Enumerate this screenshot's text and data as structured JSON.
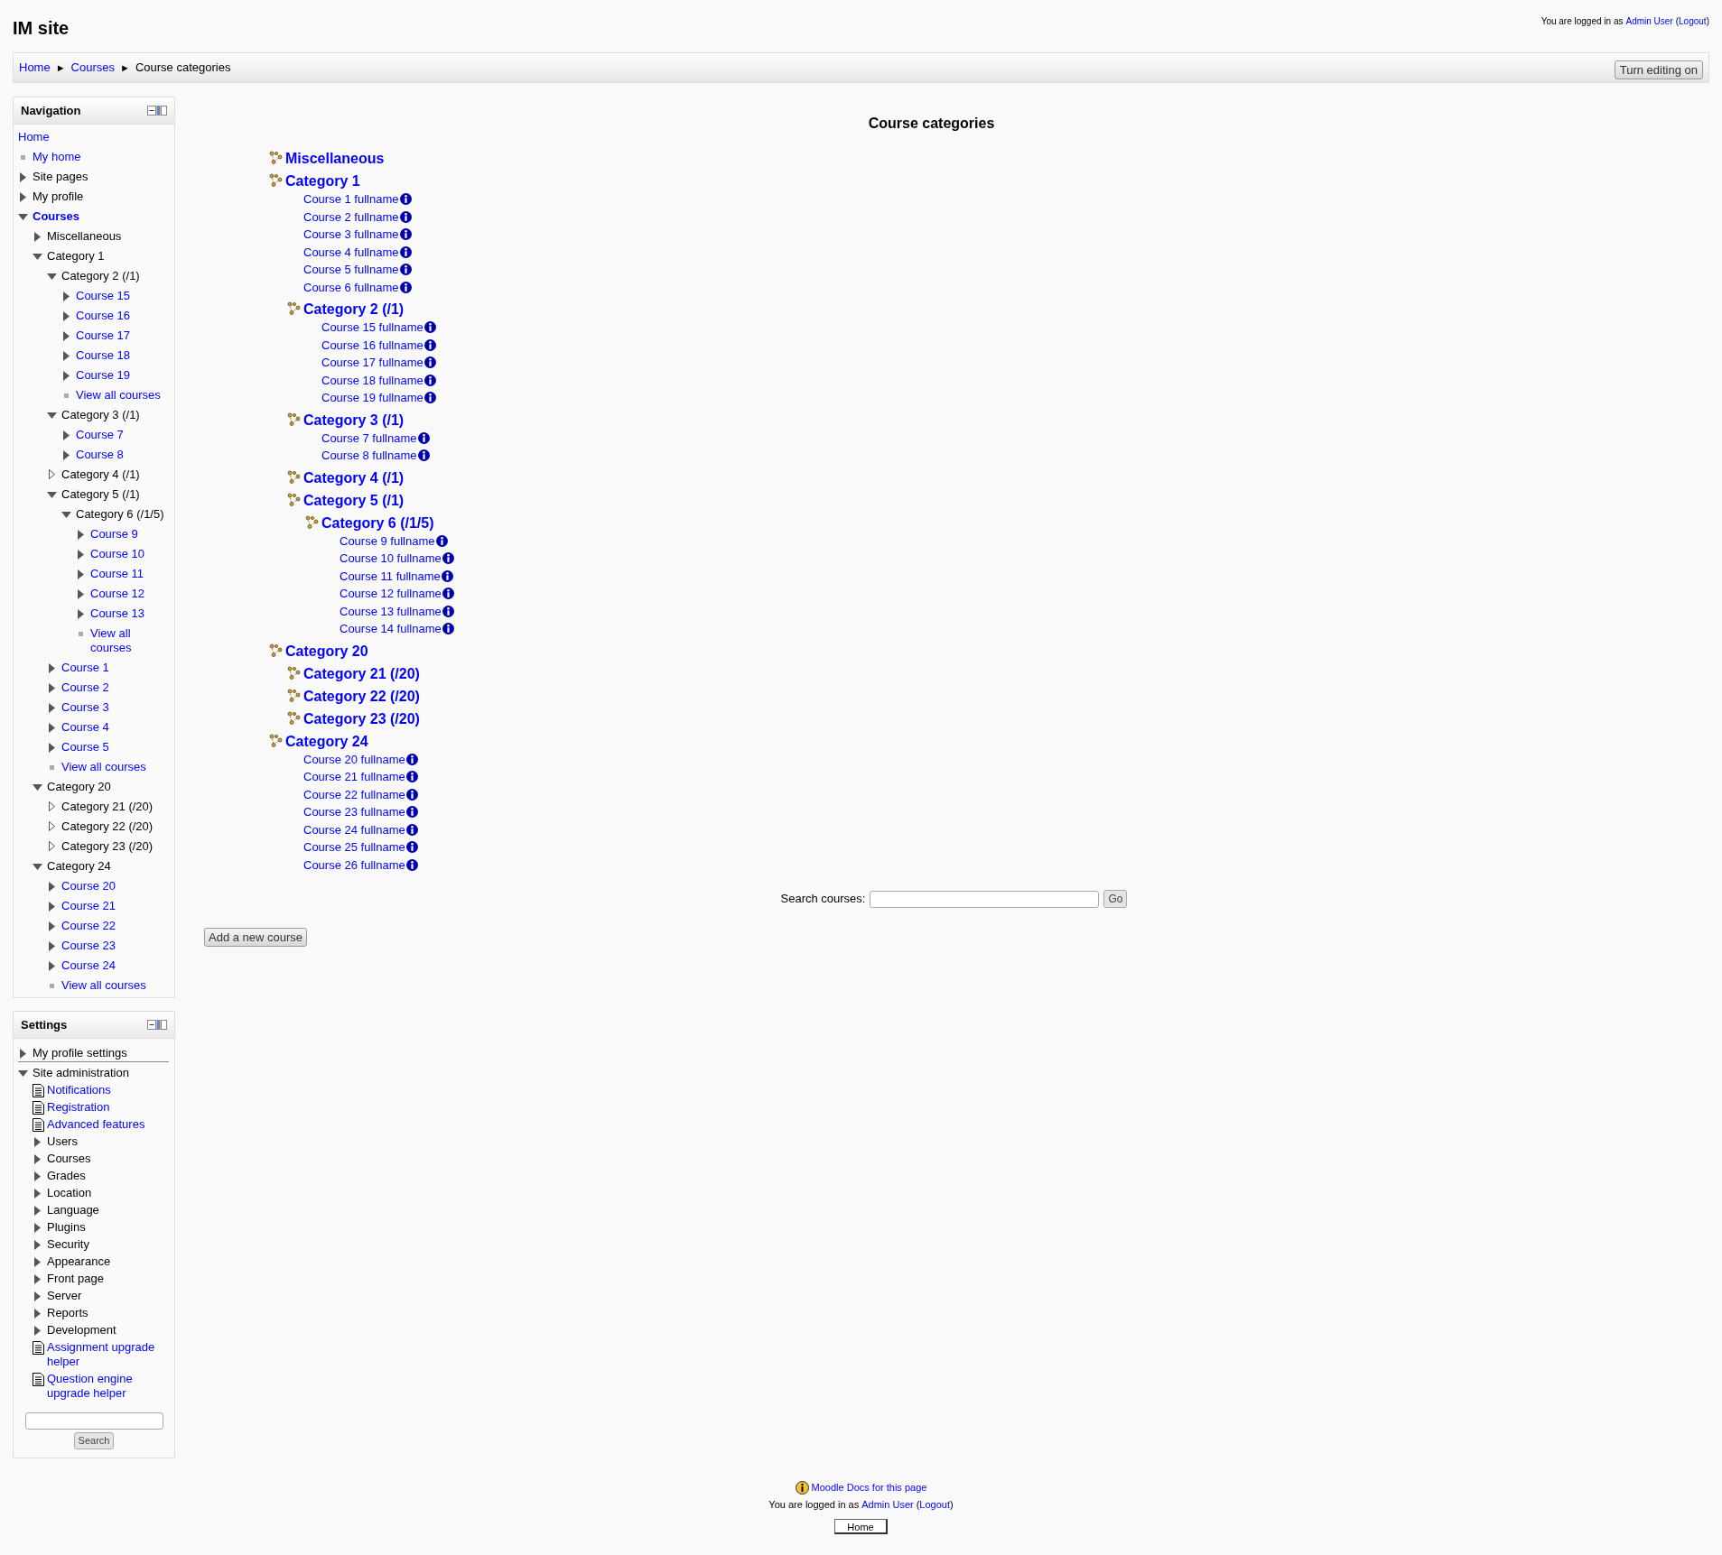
{
  "site_title": "IM site",
  "header_login": {
    "text": "You are logged in as",
    "user": "Admin User",
    "open": "(",
    "logout": "Logout",
    "close": ")"
  },
  "breadcrumb": [
    {
      "kind": "link",
      "label": "Home"
    },
    {
      "kind": "sep",
      "label": "►"
    },
    {
      "kind": "link",
      "label": "Courses"
    },
    {
      "kind": "sep",
      "label": "►"
    },
    {
      "kind": "current",
      "label": "Course categories"
    }
  ],
  "edit_button": "Turn editing on",
  "navigation": {
    "title": "Navigation",
    "items": [
      {
        "label": "Home",
        "kind": "plain",
        "link": true
      },
      {
        "label": "My home",
        "kind": "bullet",
        "link": true
      },
      {
        "label": "Site pages",
        "kind": "branch",
        "expanded": false,
        "link": false
      },
      {
        "label": "My profile",
        "kind": "branch",
        "expanded": false,
        "link": false
      },
      {
        "label": "Courses",
        "kind": "branch",
        "expanded": true,
        "link": true,
        "current": true,
        "children": [
          {
            "label": "Miscellaneous",
            "kind": "branch",
            "expanded": false,
            "link": false
          },
          {
            "label": "Category 1",
            "kind": "branch",
            "expanded": true,
            "link": false,
            "children": [
              {
                "label": "Category 2 (/1)",
                "kind": "branch",
                "expanded": true,
                "link": false,
                "children": [
                  {
                    "label": "Course 15",
                    "kind": "branch",
                    "expanded": false,
                    "link": true
                  },
                  {
                    "label": "Course 16",
                    "kind": "branch",
                    "expanded": false,
                    "link": true
                  },
                  {
                    "label": "Course 17",
                    "kind": "branch",
                    "expanded": false,
                    "link": true
                  },
                  {
                    "label": "Course 18",
                    "kind": "branch",
                    "expanded": false,
                    "link": true
                  },
                  {
                    "label": "Course 19",
                    "kind": "branch",
                    "expanded": false,
                    "link": true
                  },
                  {
                    "label": "View all courses",
                    "kind": "bullet",
                    "link": true
                  }
                ]
              },
              {
                "label": "Category 3 (/1)",
                "kind": "branch",
                "expanded": true,
                "link": false,
                "children": [
                  {
                    "label": "Course 7",
                    "kind": "branch",
                    "expanded": false,
                    "link": true
                  },
                  {
                    "label": "Course 8",
                    "kind": "branch",
                    "expanded": false,
                    "link": true
                  }
                ]
              },
              {
                "label": "Category 4 (/1)",
                "kind": "empty",
                "link": false
              },
              {
                "label": "Category 5 (/1)",
                "kind": "branch",
                "expanded": true,
                "link": false,
                "children": [
                  {
                    "label": "Category 6 (/1/5)",
                    "kind": "branch",
                    "expanded": true,
                    "link": false,
                    "children": [
                      {
                        "label": "Course 9",
                        "kind": "branch",
                        "expanded": false,
                        "link": true
                      },
                      {
                        "label": "Course 10",
                        "kind": "branch",
                        "expanded": false,
                        "link": true
                      },
                      {
                        "label": "Course 11",
                        "kind": "branch",
                        "expanded": false,
                        "link": true
                      },
                      {
                        "label": "Course 12",
                        "kind": "branch",
                        "expanded": false,
                        "link": true
                      },
                      {
                        "label": "Course 13",
                        "kind": "branch",
                        "expanded": false,
                        "link": true
                      },
                      {
                        "label": "View all courses",
                        "kind": "bullet",
                        "link": true
                      }
                    ]
                  }
                ]
              },
              {
                "label": "Course 1",
                "kind": "branch",
                "expanded": false,
                "link": true
              },
              {
                "label": "Course 2",
                "kind": "branch",
                "expanded": false,
                "link": true
              },
              {
                "label": "Course 3",
                "kind": "branch",
                "expanded": false,
                "link": true
              },
              {
                "label": "Course 4",
                "kind": "branch",
                "expanded": false,
                "link": true
              },
              {
                "label": "Course 5",
                "kind": "branch",
                "expanded": false,
                "link": true
              },
              {
                "label": "View all courses",
                "kind": "bullet",
                "link": true
              }
            ]
          },
          {
            "label": "Category 20",
            "kind": "branch",
            "expanded": true,
            "link": false,
            "children": [
              {
                "label": "Category 21 (/20)",
                "kind": "empty",
                "link": false
              },
              {
                "label": "Category 22 (/20)",
                "kind": "empty",
                "link": false
              },
              {
                "label": "Category 23 (/20)",
                "kind": "empty",
                "link": false
              }
            ]
          },
          {
            "label": "Category 24",
            "kind": "branch",
            "expanded": true,
            "link": false,
            "children": [
              {
                "label": "Course 20",
                "kind": "branch",
                "expanded": false,
                "link": true
              },
              {
                "label": "Course 21",
                "kind": "branch",
                "expanded": false,
                "link": true
              },
              {
                "label": "Course 22",
                "kind": "branch",
                "expanded": false,
                "link": true
              },
              {
                "label": "Course 23",
                "kind": "branch",
                "expanded": false,
                "link": true
              },
              {
                "label": "Course 24",
                "kind": "branch",
                "expanded": false,
                "link": true
              },
              {
                "label": "View all courses",
                "kind": "bullet",
                "link": true
              }
            ]
          }
        ]
      }
    ]
  },
  "settings": {
    "title": "Settings",
    "items": [
      {
        "label": "My profile settings",
        "kind": "branch",
        "expanded": false,
        "link": false,
        "divider_after": true
      },
      {
        "label": "Site administration",
        "kind": "branch",
        "expanded": true,
        "link": false,
        "children": [
          {
            "label": "Notifications",
            "kind": "page",
            "link": true
          },
          {
            "label": "Registration",
            "kind": "page",
            "link": true
          },
          {
            "label": "Advanced features",
            "kind": "page",
            "link": true
          },
          {
            "label": "Users",
            "kind": "branch",
            "expanded": false,
            "link": false
          },
          {
            "label": "Courses",
            "kind": "branch",
            "expanded": false,
            "link": false
          },
          {
            "label": "Grades",
            "kind": "branch",
            "expanded": false,
            "link": false
          },
          {
            "label": "Location",
            "kind": "branch",
            "expanded": false,
            "link": false
          },
          {
            "label": "Language",
            "kind": "branch",
            "expanded": false,
            "link": false
          },
          {
            "label": "Plugins",
            "kind": "branch",
            "expanded": false,
            "link": false
          },
          {
            "label": "Security",
            "kind": "branch",
            "expanded": false,
            "link": false
          },
          {
            "label": "Appearance",
            "kind": "branch",
            "expanded": false,
            "link": false
          },
          {
            "label": "Front page",
            "kind": "branch",
            "expanded": false,
            "link": false
          },
          {
            "label": "Server",
            "kind": "branch",
            "expanded": false,
            "link": false
          },
          {
            "label": "Reports",
            "kind": "branch",
            "expanded": false,
            "link": false
          },
          {
            "label": "Development",
            "kind": "branch",
            "expanded": false,
            "link": false
          },
          {
            "label": "Assignment upgrade helper",
            "kind": "page",
            "link": true
          },
          {
            "label": "Question engine upgrade helper",
            "kind": "page",
            "link": true
          }
        ]
      }
    ],
    "search_button": "Search"
  },
  "main": {
    "heading": "Course categories",
    "categories": [
      {
        "name": "Miscellaneous"
      },
      {
        "name": "Category 1",
        "courses": [
          "Course 1 fullname",
          "Course 2 fullname",
          "Course 3 fullname",
          "Course 4 fullname",
          "Course 5 fullname",
          "Course 6 fullname"
        ],
        "children": [
          {
            "name": "Category 2 (/1)",
            "courses": [
              "Course 15 fullname",
              "Course 16 fullname",
              "Course 17 fullname",
              "Course 18 fullname",
              "Course 19 fullname"
            ]
          },
          {
            "name": "Category 3 (/1)",
            "courses": [
              "Course 7 fullname",
              "Course 8 fullname"
            ]
          },
          {
            "name": "Category 4 (/1)"
          },
          {
            "name": "Category 5 (/1)",
            "children": [
              {
                "name": "Category 6 (/1/5)",
                "courses": [
                  "Course 9 fullname",
                  "Course 10 fullname",
                  "Course 11 fullname",
                  "Course 12 fullname",
                  "Course 13 fullname",
                  "Course 14 fullname"
                ]
              }
            ]
          }
        ]
      },
      {
        "name": "Category 20",
        "children": [
          {
            "name": "Category 21 (/20)"
          },
          {
            "name": "Category 22 (/20)"
          },
          {
            "name": "Category 23 (/20)"
          }
        ]
      },
      {
        "name": "Category 24",
        "courses": [
          "Course 20 fullname",
          "Course 21 fullname",
          "Course 22 fullname",
          "Course 23 fullname",
          "Course 24 fullname",
          "Course 25 fullname",
          "Course 26 fullname"
        ]
      }
    ],
    "search_label": "Search courses:",
    "search_button": "Go",
    "add_button": "Add a new course"
  },
  "footer": {
    "docs_link": "Moodle Docs for this page",
    "login": {
      "text": "You are logged in as",
      "user": "Admin User",
      "open": "(",
      "logout": "Logout",
      "close": ")"
    },
    "home_button": "Home"
  }
}
